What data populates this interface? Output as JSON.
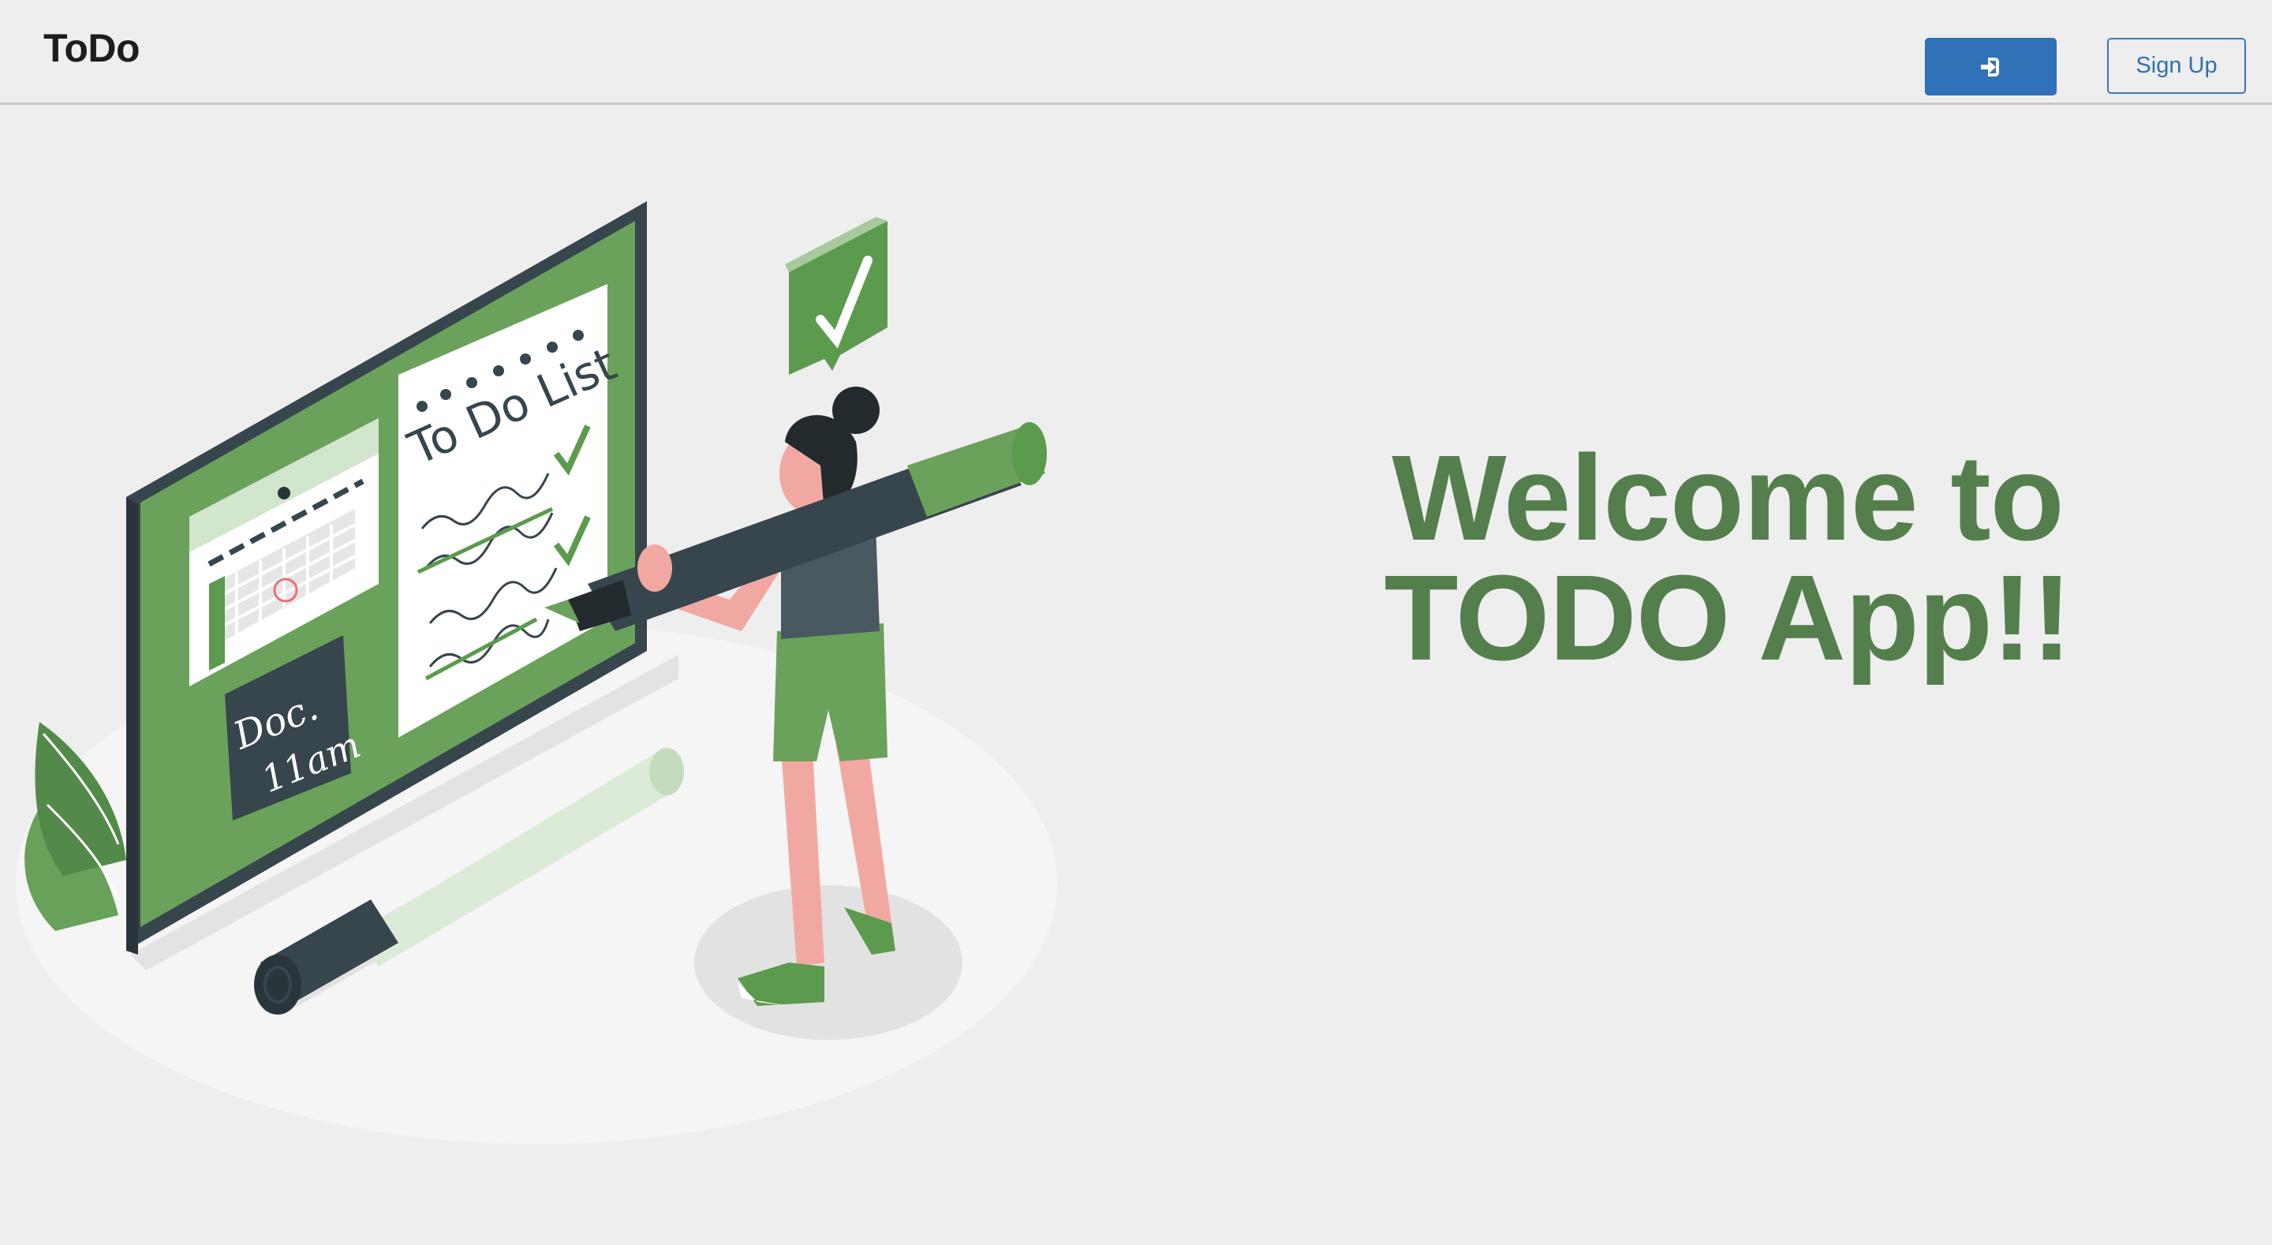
{
  "navbar": {
    "brand": "ToDo",
    "login_icon": "sign-in-icon",
    "signup_label": "Sign Up"
  },
  "hero": {
    "line1": "Welcome to",
    "line2": "TODO App!!",
    "illustration": {
      "todo_title": "To Do List",
      "note_line1": "Doc.",
      "note_line2": "11am"
    }
  },
  "colors": {
    "accent_green": "#547f4d",
    "login_button": "#2f72b8",
    "background": "#eeeeee"
  }
}
